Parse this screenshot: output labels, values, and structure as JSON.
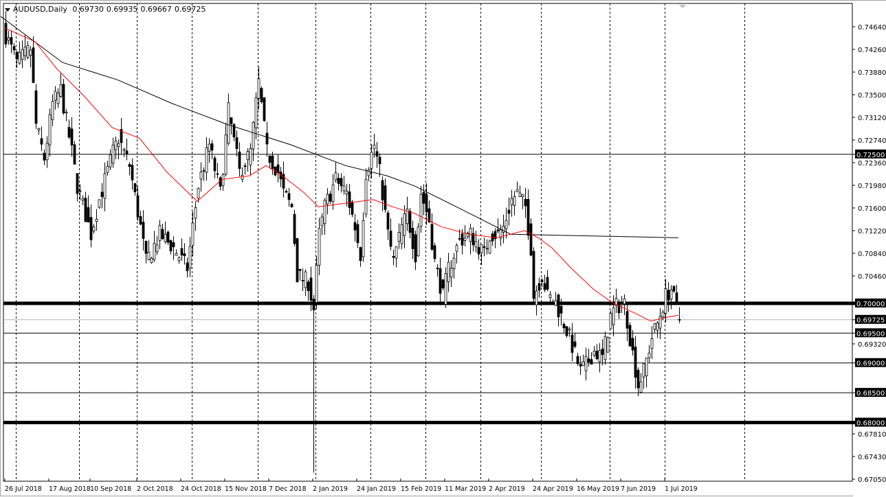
{
  "header": {
    "symbol": "AUDUSD,Daily",
    "open": "0.69730",
    "high": "0.69935",
    "low": "0.69667",
    "close": "0.69725"
  },
  "colors": {
    "candle": "#000000",
    "ma_fast": "#ff0000",
    "ma_slow": "#000000",
    "bg": "#ffffff"
  },
  "chart_data": {
    "type": "candlestick",
    "title": "AUDUSD,Daily",
    "ylim": [
      0.6705,
      0.7464
    ],
    "y_ticks": [
      "0.74640",
      "0.74260",
      "0.73880",
      "0.73500",
      "0.73120",
      "0.72740",
      "0.72360",
      "0.71980",
      "0.71600",
      "0.71220",
      "0.70840",
      "0.70460",
      "0.69320",
      "0.67810",
      "0.67430",
      "0.67050"
    ],
    "x_ticks": [
      {
        "label": "26 Jul 2018",
        "day": 0
      },
      {
        "label": "17 Aug 2018",
        "day": 16
      },
      {
        "label": "10 Sep 2018",
        "day": 31
      },
      {
        "label": "2 Oct 2018",
        "day": 48
      },
      {
        "label": "24 Oct 2018",
        "day": 64
      },
      {
        "label": "15 Nov 2018",
        "day": 80
      },
      {
        "label": "7 Dec 2018",
        "day": 96
      },
      {
        "label": "2 Jan 2019",
        "day": 112
      },
      {
        "label": "24 Jan 2019",
        "day": 128
      },
      {
        "label": "15 Feb 2019",
        "day": 144
      },
      {
        "label": "11 Mar 2019",
        "day": 160
      },
      {
        "label": "2 Apr 2019",
        "day": 176
      },
      {
        "label": "24 Apr 2019",
        "day": 192
      },
      {
        "label": "16 May 2019",
        "day": 208
      },
      {
        "label": "7 Jun 2019",
        "day": 224
      },
      {
        "label": "1 Jul 2019",
        "day": 240
      }
    ],
    "grid_days": [
      4,
      27,
      48,
      68,
      92,
      113,
      133,
      153,
      173,
      195,
      220,
      240,
      269
    ],
    "close_anchors": [
      [
        0,
        0.745
      ],
      [
        4,
        0.7404
      ],
      [
        9,
        0.7427
      ],
      [
        11,
        0.73
      ],
      [
        14,
        0.7243
      ],
      [
        17,
        0.7335
      ],
      [
        20,
        0.7358
      ],
      [
        24,
        0.7254
      ],
      [
        26,
        0.7197
      ],
      [
        31,
        0.7116
      ],
      [
        34,
        0.7174
      ],
      [
        39,
        0.7254
      ],
      [
        41,
        0.7277
      ],
      [
        45,
        0.7231
      ],
      [
        49,
        0.7128
      ],
      [
        51,
        0.707
      ],
      [
        56,
        0.7116
      ],
      [
        61,
        0.7093
      ],
      [
        66,
        0.7059
      ],
      [
        70,
        0.7197
      ],
      [
        74,
        0.7266
      ],
      [
        78,
        0.7185
      ],
      [
        81,
        0.7323
      ],
      [
        85,
        0.722
      ],
      [
        89,
        0.7254
      ],
      [
        91,
        0.7335
      ],
      [
        92,
        0.737
      ],
      [
        95,
        0.7254
      ],
      [
        99,
        0.722
      ],
      [
        101,
        0.7185
      ],
      [
        104,
        0.7162
      ],
      [
        106,
        0.7047
      ],
      [
        110,
        0.7035
      ],
      [
        112,
        0.699
      ],
      [
        114,
        0.7116
      ],
      [
        116,
        0.7162
      ],
      [
        120,
        0.7208
      ],
      [
        124,
        0.7185
      ],
      [
        127,
        0.7128
      ],
      [
        129,
        0.7082
      ],
      [
        131,
        0.722
      ],
      [
        134,
        0.7266
      ],
      [
        136,
        0.722
      ],
      [
        139,
        0.7116
      ],
      [
        141,
        0.707
      ],
      [
        144,
        0.7128
      ],
      [
        146,
        0.7151
      ],
      [
        149,
        0.7082
      ],
      [
        151,
        0.7185
      ],
      [
        154,
        0.7139
      ],
      [
        156,
        0.707
      ],
      [
        159,
        0.7012
      ],
      [
        161,
        0.7059
      ],
      [
        165,
        0.7105
      ],
      [
        169,
        0.7116
      ],
      [
        174,
        0.7082
      ],
      [
        176,
        0.7116
      ],
      [
        179,
        0.7116
      ],
      [
        181,
        0.7128
      ],
      [
        184,
        0.7174
      ],
      [
        186,
        0.7185
      ],
      [
        189,
        0.7162
      ],
      [
        191,
        0.7093
      ],
      [
        192,
        0.7012
      ],
      [
        195,
        0.7047
      ],
      [
        197,
        0.7012
      ],
      [
        200,
        0.7001
      ],
      [
        202,
        0.6978
      ],
      [
        205,
        0.6943
      ],
      [
        209,
        0.6886
      ],
      [
        211,
        0.6897
      ],
      [
        214,
        0.692
      ],
      [
        217,
        0.6909
      ],
      [
        220,
        0.6978
      ],
      [
        222,
        0.6995
      ],
      [
        225,
        0.7001
      ],
      [
        227,
        0.6943
      ],
      [
        230,
        0.6863
      ],
      [
        232,
        0.6886
      ],
      [
        235,
        0.6943
      ],
      [
        237,
        0.6966
      ],
      [
        240,
        0.7012
      ],
      [
        242,
        0.7024
      ],
      [
        245,
        0.69725
      ]
    ],
    "ma_slow": [
      [
        -4,
        0.749
      ],
      [
        21,
        0.7404
      ],
      [
        41,
        0.7375
      ],
      [
        61,
        0.7335
      ],
      [
        81,
        0.73
      ],
      [
        104,
        0.7266
      ],
      [
        124,
        0.7231
      ],
      [
        139,
        0.7214
      ],
      [
        149,
        0.7197
      ],
      [
        169,
        0.7151
      ],
      [
        184,
        0.7116
      ],
      [
        245,
        0.711
      ]
    ],
    "ma_fast": [
      [
        0,
        0.7462
      ],
      [
        11,
        0.7439
      ],
      [
        19,
        0.7393
      ],
      [
        29,
        0.7347
      ],
      [
        39,
        0.7295
      ],
      [
        49,
        0.7277
      ],
      [
        59,
        0.722
      ],
      [
        70,
        0.7171
      ],
      [
        79,
        0.7208
      ],
      [
        89,
        0.7214
      ],
      [
        95,
        0.7231
      ],
      [
        101,
        0.7214
      ],
      [
        109,
        0.7185
      ],
      [
        114,
        0.7162
      ],
      [
        124,
        0.7168
      ],
      [
        134,
        0.7174
      ],
      [
        141,
        0.7162
      ],
      [
        149,
        0.7151
      ],
      [
        159,
        0.7128
      ],
      [
        169,
        0.7116
      ],
      [
        179,
        0.711
      ],
      [
        189,
        0.7122
      ],
      [
        194,
        0.711
      ],
      [
        199,
        0.7093
      ],
      [
        206,
        0.7059
      ],
      [
        214,
        0.7024
      ],
      [
        221,
        0.7001
      ],
      [
        229,
        0.6984
      ],
      [
        235,
        0.697
      ],
      [
        240,
        0.6976
      ],
      [
        245,
        0.698
      ]
    ],
    "levels": [
      {
        "price": 0.725,
        "label": "0.72500",
        "weight": "thin"
      },
      {
        "price": 0.7,
        "label": "0.70000",
        "weight": "thick"
      },
      {
        "price": 0.69725,
        "label": "0.69725",
        "weight": "current"
      },
      {
        "price": 0.695,
        "label": "0.69500",
        "weight": "thin"
      },
      {
        "price": 0.69,
        "label": "0.69000",
        "weight": "thin"
      },
      {
        "price": 0.685,
        "label": "0.68500",
        "weight": "thin"
      },
      {
        "price": 0.68,
        "label": "0.68000",
        "weight": "thick"
      }
    ]
  }
}
